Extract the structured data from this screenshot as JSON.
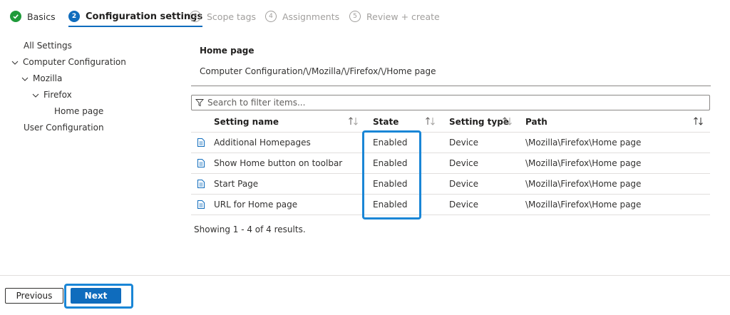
{
  "wizard": {
    "steps": [
      {
        "number": "",
        "label": "Basics",
        "state": "done"
      },
      {
        "number": "2",
        "label": "Configuration settings",
        "state": "active"
      },
      {
        "number": "3",
        "label": "Scope tags",
        "state": "todo"
      },
      {
        "number": "4",
        "label": "Assignments",
        "state": "todo"
      },
      {
        "number": "5",
        "label": "Review + create",
        "state": "todo"
      }
    ]
  },
  "tree": {
    "items": [
      {
        "label": "All Settings"
      },
      {
        "label": "Computer Configuration"
      },
      {
        "label": "Mozilla"
      },
      {
        "label": "Firefox"
      },
      {
        "label": "Home page"
      },
      {
        "label": "User Configuration"
      }
    ]
  },
  "main": {
    "title": "Home page",
    "breadcrumb": "Computer Configuration/\\/Mozilla/\\/Firefox/\\/Home page",
    "search_placeholder": "Search to filter items...",
    "columns": {
      "name": "Setting name",
      "state": "State",
      "type": "Setting type",
      "path": "Path"
    },
    "rows": [
      {
        "name": "Additional Homepages",
        "state": "Enabled",
        "type": "Device",
        "path": "\\Mozilla\\Firefox\\Home page"
      },
      {
        "name": "Show Home button on toolbar",
        "state": "Enabled",
        "type": "Device",
        "path": "\\Mozilla\\Firefox\\Home page"
      },
      {
        "name": "Start Page",
        "state": "Enabled",
        "type": "Device",
        "path": "\\Mozilla\\Firefox\\Home page"
      },
      {
        "name": "URL for Home page",
        "state": "Enabled",
        "type": "Device",
        "path": "\\Mozilla\\Firefox\\Home page"
      }
    ],
    "results_text": "Showing 1 - 4 of 4 results."
  },
  "footer": {
    "previous_label": "Previous",
    "next_label": "Next"
  },
  "colors": {
    "accent": "#0f6cbd",
    "highlight": "#1a86d6",
    "success": "#1f9a3a"
  },
  "icons": {
    "step_done": "checkmark-icon",
    "tree_expand": "chevron-down-icon",
    "search": "filter-icon",
    "row": "document-icon",
    "sort": "sort-arrows-icon"
  }
}
